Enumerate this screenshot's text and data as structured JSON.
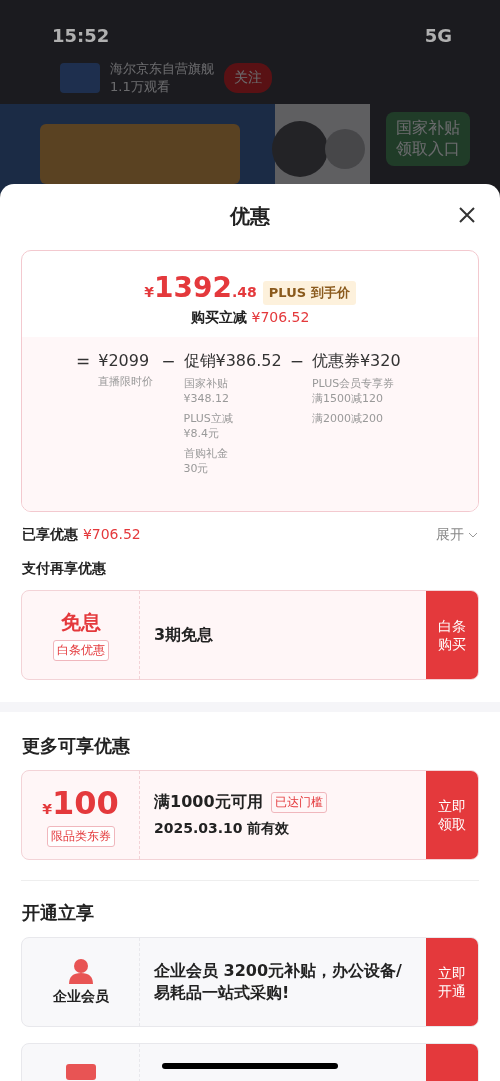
{
  "backdrop": {
    "status_bar": {
      "time": "15:52",
      "network": "5G"
    },
    "store": {
      "name": "海尔京东自营旗舰",
      "viewers": "1.1万观看",
      "follow": "关注"
    },
    "banner": {
      "kind": "picture",
      "subsidy": [
        "国家补贴",
        "领取入口"
      ]
    }
  },
  "sheet": {
    "title": "优惠",
    "summary": {
      "currency": "¥",
      "price_int": "1392",
      "price_dec": ".48",
      "price_tag": "PLUS 到手价",
      "cut_label": "购买立减",
      "cut_value": "¥706.52",
      "terms": [
        {
          "op": "=",
          "title": "¥2099",
          "details": [
            [
              "直播限时价"
            ]
          ]
        },
        {
          "op": "−",
          "title": "促销¥386.52",
          "details": [
            [
              "国家补贴",
              "¥348.12"
            ],
            [
              "PLUS立减",
              "¥8.4元"
            ],
            [
              "首购礼金",
              "30元"
            ]
          ]
        },
        {
          "op": "−",
          "title": "优惠券¥320",
          "details": [
            [
              "PLUS会员专享券",
              "满1500减120"
            ],
            [
              "满2000减200"
            ]
          ]
        }
      ]
    },
    "enjoyed": {
      "label": "已享优惠",
      "value": "¥706.52",
      "toggle": "展开",
      "expanded": false
    },
    "pay_title": "支付再享优惠",
    "pay_offers": [
      {
        "kind": "text",
        "big": "免息",
        "tag": "白条优惠",
        "desc": "3期免息",
        "action": "白条购买"
      }
    ],
    "more_title": "更多可享优惠",
    "coupons": [
      {
        "kind": "amount",
        "currency": "¥",
        "amount": "100",
        "tag": "限品类东券",
        "condition": "满1000元可用",
        "badge": "已达门槛",
        "validity": "2025.03.10 前有效",
        "action": "立即领取"
      }
    ],
    "open_title": "开通立享",
    "memberships": [
      {
        "kind": "full",
        "name": "企业会员",
        "desc": "企业会员 3200元补贴，办公设备/易耗品一站式采购!",
        "action": "立即开通"
      },
      {
        "kind": "cut"
      }
    ]
  }
}
